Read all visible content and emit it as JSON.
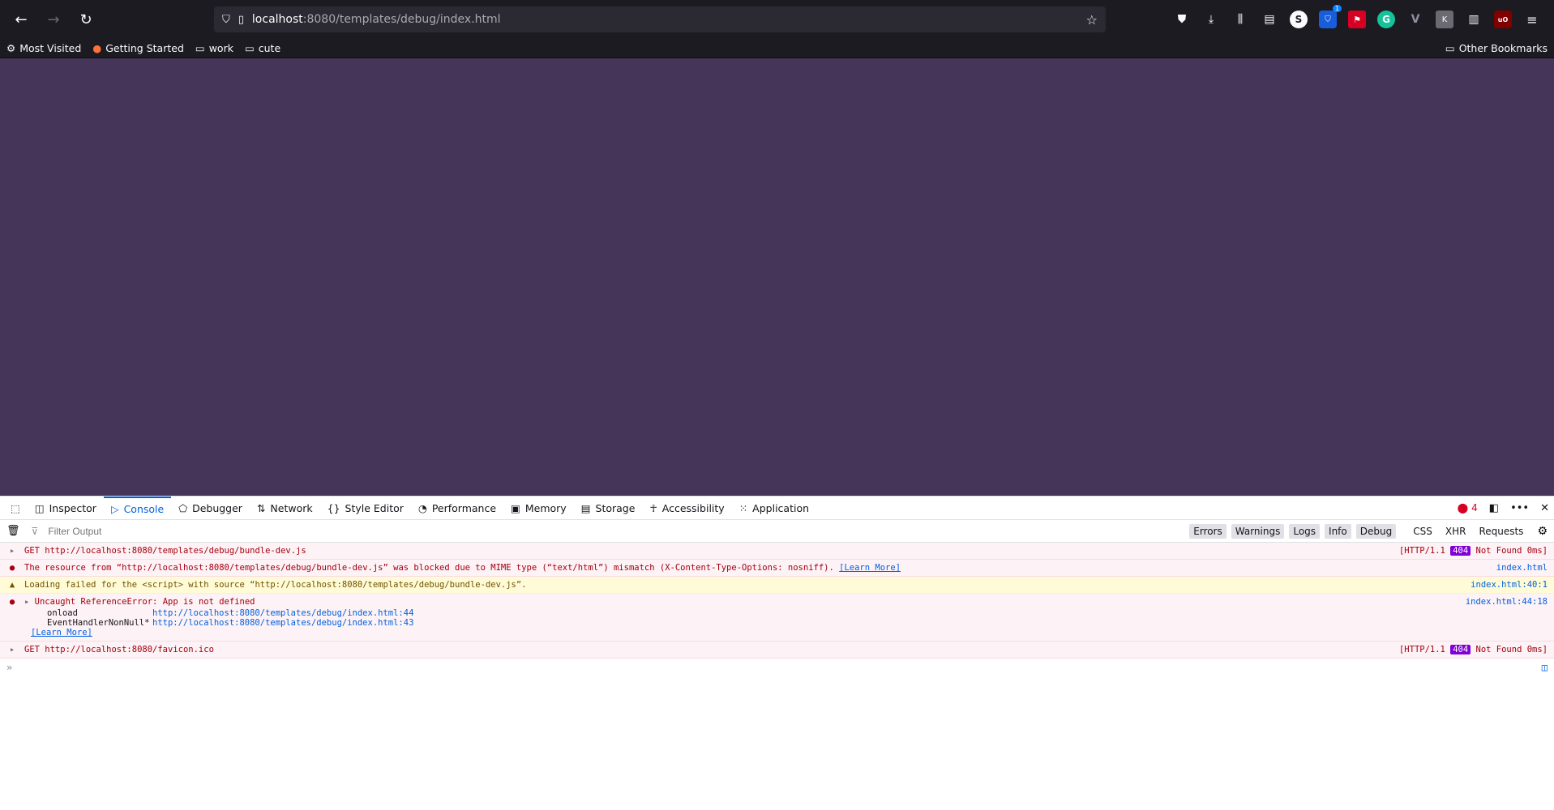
{
  "browser": {
    "url_host": "localhost",
    "url_rest": ":8080/templates/debug/index.html",
    "bookmarks": [
      "Most Visited",
      "Getting Started",
      "work",
      "cute"
    ],
    "other_bookmarks": "Other Bookmarks",
    "ext_badge": "1"
  },
  "devtools": {
    "tabs": [
      "Inspector",
      "Console",
      "Debugger",
      "Network",
      "Style Editor",
      "Performance",
      "Memory",
      "Storage",
      "Accessibility",
      "Application"
    ],
    "error_count": "4",
    "filter_placeholder": "Filter Output",
    "filters": [
      "Errors",
      "Warnings",
      "Logs",
      "Info",
      "Debug",
      "CSS",
      "XHR",
      "Requests"
    ],
    "messages": [
      {
        "text": "GET http://localhost:8080/templates/debug/bundle-dev.js",
        "status_pre": "[HTTP/1.1 ",
        "status_code": "404",
        "status_post": " Not Found 0ms]"
      },
      {
        "text": "The resource from “http://localhost:8080/templates/debug/bundle-dev.js” was blocked due to MIME type (“text/html”) mismatch (X-Content-Type-Options: nosniff).",
        "learn": "[Learn More]",
        "src": "index.html"
      },
      {
        "text": "Loading failed for the <script> with source “http://localhost:8080/templates/debug/bundle-dev.js”.",
        "src": "index.html:40:1"
      },
      {
        "text": "Uncaught ReferenceError: App is not defined",
        "src": "index.html:44:18",
        "trace": [
          {
            "fn": "onload",
            "url": "http://localhost:8080/templates/debug/index.html:44"
          },
          {
            "fn": "EventHandlerNonNull*",
            "url": "http://localhost:8080/templates/debug/index.html:43"
          }
        ],
        "learn": "[Learn More]"
      },
      {
        "text": "GET http://localhost:8080/favicon.ico",
        "status_pre": "[HTTP/1.1 ",
        "status_code": "404",
        "status_post": " Not Found 0ms]"
      }
    ],
    "input_prompt": "»"
  }
}
